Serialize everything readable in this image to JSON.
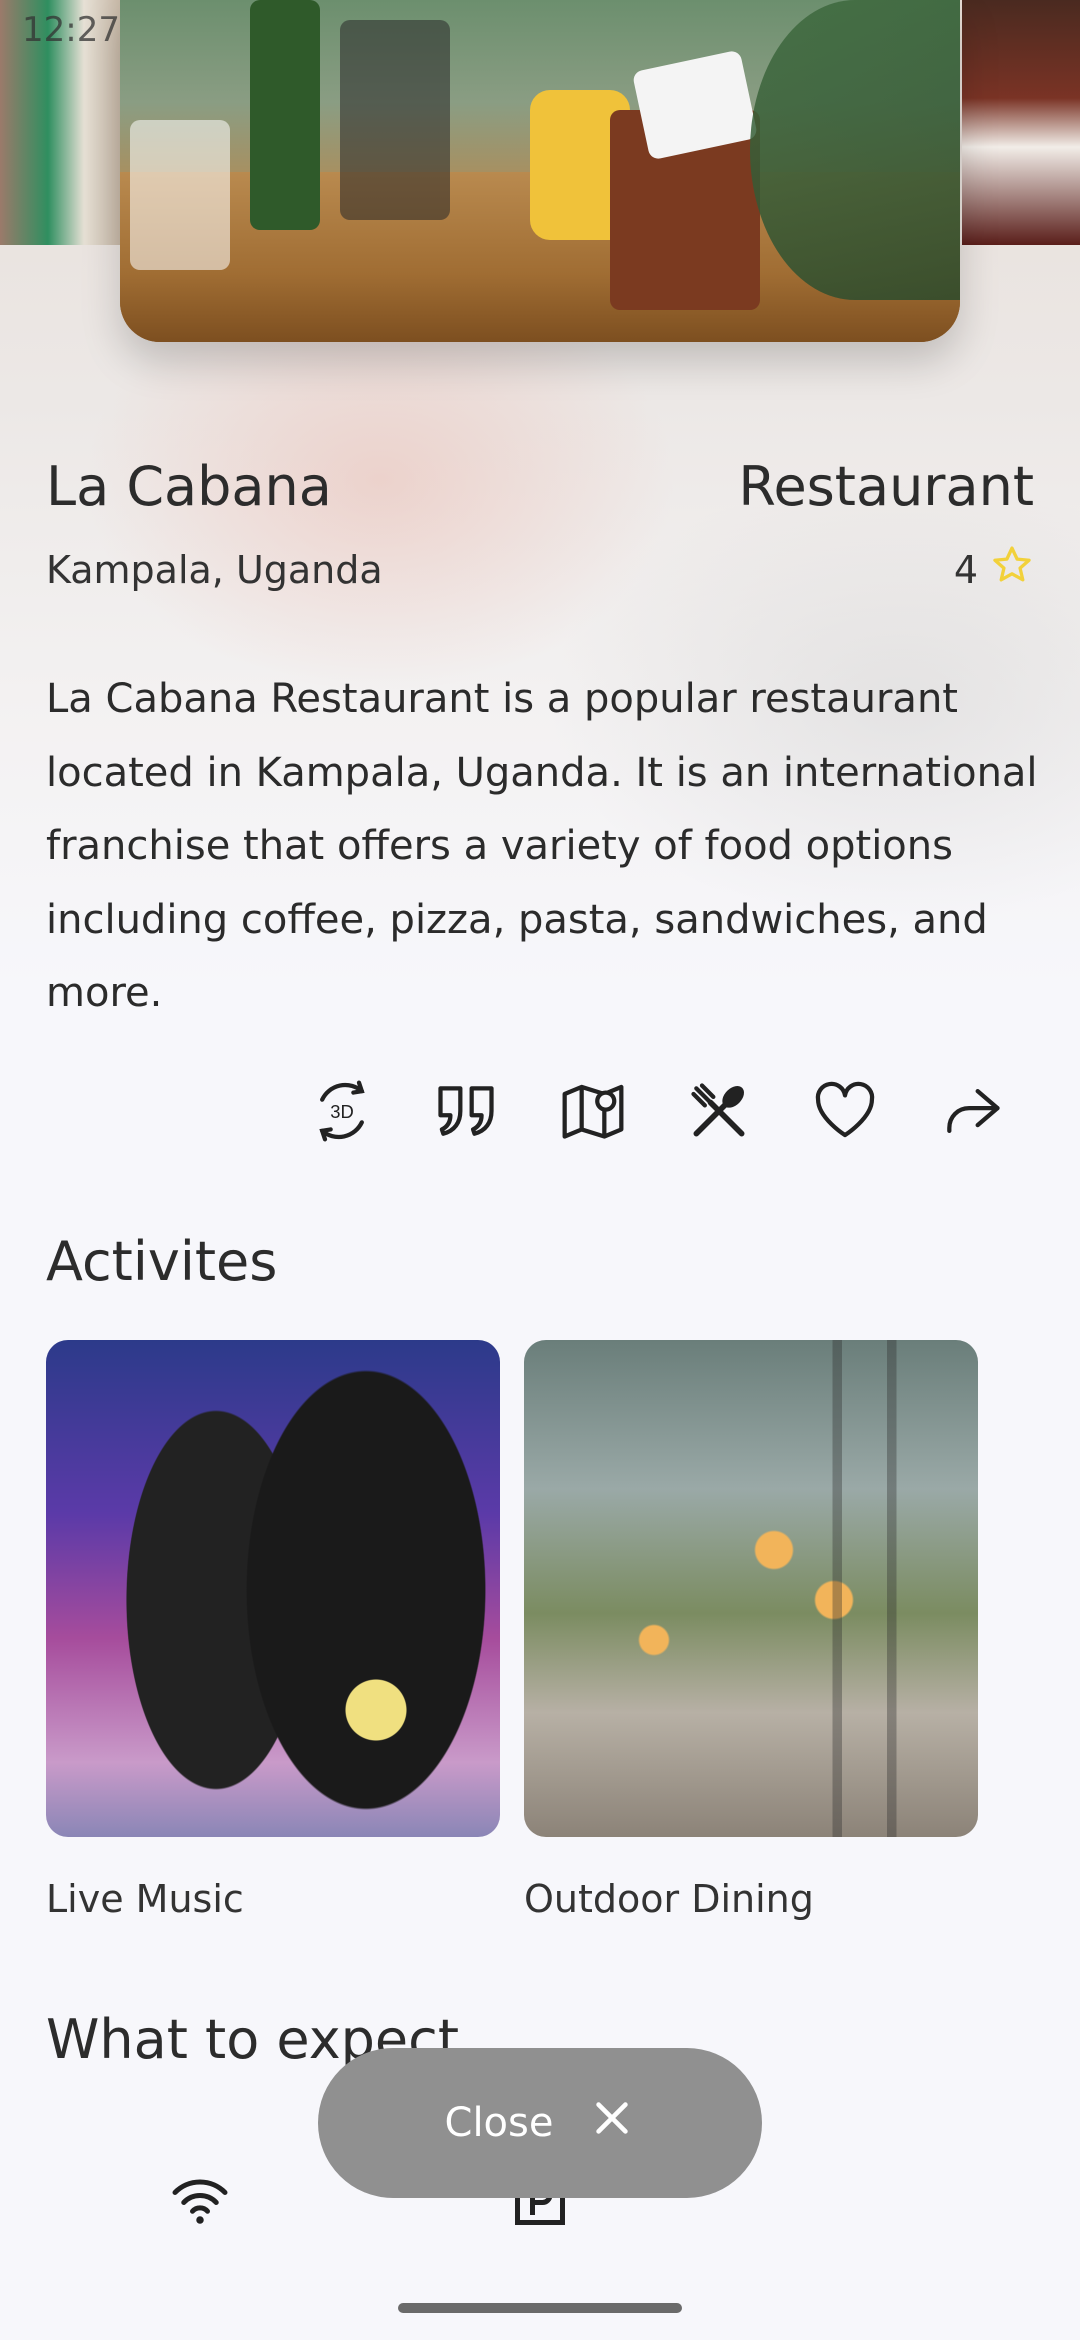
{
  "status_bar": {
    "time": "12:27"
  },
  "venue": {
    "name": "La Cabana",
    "category": "Restaurant",
    "location": "Kampala, Uganda",
    "rating": "4",
    "description": "La Cabana Restaurant is a popular restaurant located in Kampala, Uganda. It is an international franchise that offers a variety of food options including coffee, pizza, pasta, sandwiches, and more."
  },
  "actions": [
    {
      "icon": "3d-rotate-icon"
    },
    {
      "icon": "quote-icon"
    },
    {
      "icon": "map-pin-icon"
    },
    {
      "icon": "fork-spoon-icon"
    },
    {
      "icon": "heart-icon"
    },
    {
      "icon": "share-icon"
    }
  ],
  "activities": {
    "title": "Activites",
    "items": [
      {
        "label": "Live Music"
      },
      {
        "label": "Outdoor Dining"
      }
    ]
  },
  "expect": {
    "title": "What to expect",
    "amenities": [
      {
        "icon": "wifi-icon"
      },
      {
        "icon": "parking-icon"
      }
    ]
  },
  "close_button": {
    "label": "Close"
  },
  "colors": {
    "star": "#f2d13a",
    "close_bg": "#909090"
  }
}
